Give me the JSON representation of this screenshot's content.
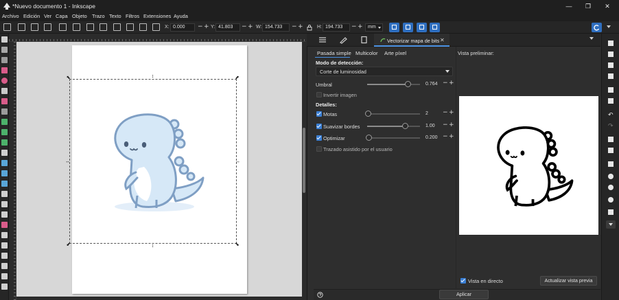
{
  "window": {
    "title": "*Nuevo documento 1 - Inkscape",
    "buttons": {
      "minimize": "—",
      "maximize": "❐",
      "close": "✕"
    }
  },
  "menu": [
    "Archivo",
    "Edición",
    "Ver",
    "Capa",
    "Objeto",
    "Trazo",
    "Texto",
    "Filtros",
    "Extensiones",
    "Ayuda"
  ],
  "toolbar": {
    "x_label": "X:",
    "x_value": "0.000",
    "y_label": "Y:",
    "y_value": "41.803",
    "w_label": "W:",
    "w_value": "154.733",
    "h_label": "H:",
    "h_value": "194.733",
    "unit": "mm",
    "minus": "−",
    "plus": "+"
  },
  "dialog": {
    "tab_label": "Vectorizar mapa de bits",
    "tab_close": "✕",
    "subtabs": [
      "Pasada simple",
      "Multicolor",
      "Arte píxel"
    ],
    "active_subtab": "Pasada simple",
    "detection_mode_label": "Modo de detección:",
    "detection_mode_value": "Corte de luminosidad",
    "threshold_label": "Umbral",
    "threshold_value": "0.764",
    "threshold_fraction": 0.764,
    "invert_label": "Invertir imagen",
    "invert_checked": false,
    "details_label": "Detalles:",
    "speckles_label": "Motas",
    "speckles_checked": true,
    "speckles_value": "2",
    "smooth_label": "Suavizar bordes",
    "smooth_checked": true,
    "smooth_value": "1.00",
    "optimize_label": "Optimizar",
    "optimize_checked": true,
    "optimize_value": "0.200",
    "stack_label": "Trazado asistido por el usuario",
    "stack_checked": false,
    "preview_label": "Vista preliminar:",
    "live_preview_label": "Vista en directo",
    "live_preview_checked": true,
    "update_preview_label": "Actualizar vista previa",
    "apply_label": "Aplicar"
  },
  "colors": {
    "accent": "#4a90e2",
    "dino_fill": "#d6e8f7",
    "dino_stroke": "#7f9fc4"
  },
  "icons": {
    "toolbox": [
      "selector-icon",
      "node-icon",
      "tweak-icon",
      "rect-icon",
      "ellipse-icon",
      "star-icon",
      "spiral-icon",
      "pencil-icon",
      "pen-icon",
      "calligraphy-icon",
      "text-icon",
      "gradient-icon",
      "mesh-icon",
      "dropper-icon",
      "paint-bucket-icon",
      "eraser-icon",
      "spray-icon",
      "connector-icon",
      "measure-icon",
      "zoom-icon"
    ],
    "commands": [
      "new-icon",
      "open-icon",
      "save-icon",
      "print-icon",
      "import-icon",
      "export-icon",
      "undo-icon",
      "redo-icon",
      "copy-icon",
      "paste-icon",
      "zoom-selection-icon",
      "zoom-drawing-icon",
      "zoom-page-icon",
      "duplicate-icon",
      "more-icon"
    ]
  }
}
